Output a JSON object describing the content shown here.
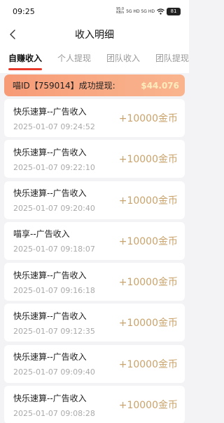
{
  "status": {
    "time": "09:25",
    "speed_top": "95.0",
    "speed_bottom": "KB/s",
    "signal": "5G HD 5G HD",
    "battery": "81"
  },
  "header": {
    "title": "收入明细"
  },
  "tabs": [
    {
      "label": "自赚收入",
      "active": true
    },
    {
      "label": "个人提现",
      "active": false
    },
    {
      "label": "团队收入",
      "active": false
    },
    {
      "label": "团队提现",
      "active": false
    }
  ],
  "banner": {
    "text": "喵ID【759014】成功提现:",
    "amount": "$44.076"
  },
  "records": [
    {
      "title": "快乐速算--广告收入",
      "time": "2025-01-07 09:24:52",
      "amount": "+10000金币"
    },
    {
      "title": "快乐速算--广告收入",
      "time": "2025-01-07 09:22:10",
      "amount": "+10000金币"
    },
    {
      "title": "快乐速算--广告收入",
      "time": "2025-01-07 09:20:40",
      "amount": "+10000金币"
    },
    {
      "title": "喵享--广告收入",
      "time": "2025-01-07 09:18:07",
      "amount": "+10000金币"
    },
    {
      "title": "快乐速算--广告收入",
      "time": "2025-01-07 09:16:18",
      "amount": "+10000金币"
    },
    {
      "title": "快乐速算--广告收入",
      "time": "2025-01-07 09:12:35",
      "amount": "+10000金币"
    },
    {
      "title": "快乐速算--广告收入",
      "time": "2025-01-07 09:09:40",
      "amount": "+10000金币"
    },
    {
      "title": "快乐速算--广告收入",
      "time": "2025-01-07 09:08:28",
      "amount": "+10000金币"
    }
  ],
  "colors": {
    "tab_indicator": "#e8382a",
    "amount": "#c9a36b",
    "banner": "#f79a76"
  },
  "icons": {
    "back": "back-arrow-icon",
    "wifi": "wifi-icon",
    "battery": "battery-icon"
  }
}
